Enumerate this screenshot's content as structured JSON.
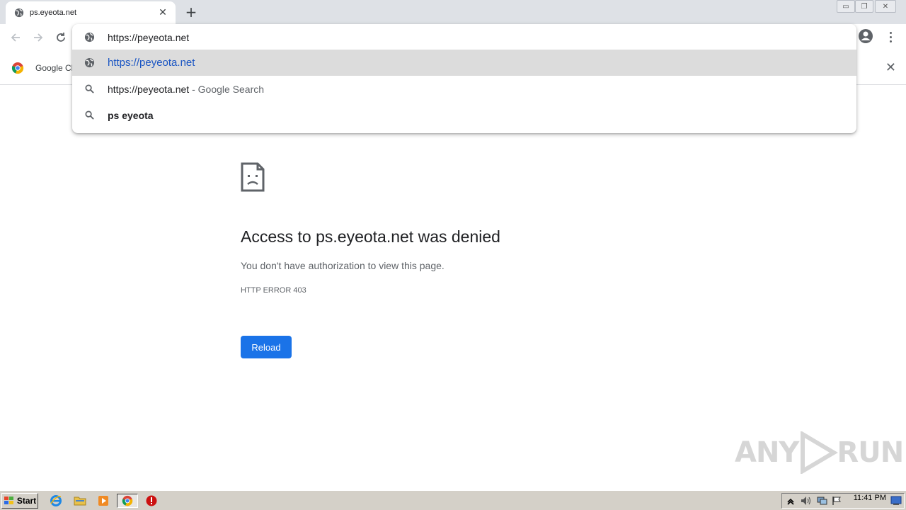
{
  "browser": {
    "tab": {
      "title": "ps.eyeota.net",
      "close_glyph": "✕"
    },
    "new_tab_glyph": "+",
    "window_controls": [
      "▭",
      "❐",
      "✕"
    ]
  },
  "omnibox": {
    "input_value": "https://peyeota.net",
    "suggestions": [
      {
        "text": "https://peyeota.net",
        "icon": "globe-icon",
        "selected": true
      },
      {
        "text": "https://peyeota.net",
        "suffix": " - Google Search",
        "icon": "search-icon"
      },
      {
        "text": "ps eyeota",
        "icon": "search-icon"
      }
    ]
  },
  "bookmarks": {
    "item_label": "Google Cl",
    "close_glyph": "✕"
  },
  "error_page": {
    "title": "Access to ps.eyeota.net was denied",
    "message": "You don't have authorization to view this page.",
    "code": "HTTP ERROR 403",
    "reload_label": "Reload"
  },
  "watermark": {
    "left": "ANY",
    "right": "RUN"
  },
  "taskbar": {
    "start_label": "Start",
    "clock": "11:41 PM"
  },
  "colors": {
    "accent": "#1a73e8",
    "selected_suggestion": "#1a55c3",
    "tabstrip": "#dee1e6",
    "taskbar": "#d4d0c8"
  }
}
